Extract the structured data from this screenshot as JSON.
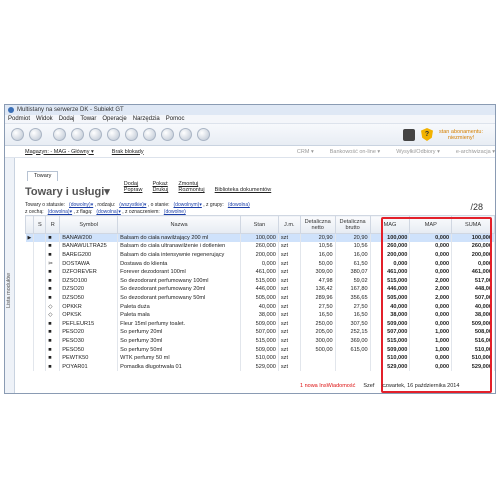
{
  "window": {
    "title": "Multistany na serwerze DK - Subiekt GT"
  },
  "menu": [
    "Podmiot",
    "Widok",
    "Dodaj",
    "Towar",
    "Operacje",
    "Narzędzia",
    "Pomoc"
  ],
  "promo": {
    "text": "stan abonamentu: niezmieny!"
  },
  "bar2": {
    "magazyn": "Magazyn: - MAG - Główny ▾",
    "blokady": "Brak blokady",
    "crm": "CRM ▾",
    "bank": "Bankowość on-line ▾",
    "wysylki": "Wysyłki/Odbiory ▾",
    "archiwizacja": "e-archiwizacja ▾"
  },
  "sidebar": {
    "label": "Lista modułów"
  },
  "tab": {
    "label": "Towary"
  },
  "header": {
    "title": "Towary i usługi",
    "title_caret": "▾",
    "count": "/28",
    "actions": [
      "Dodaj",
      "Pokaż",
      "Zmontuj",
      "",
      "Popraw",
      "Drukuj",
      "Rozmontuj",
      "Biblioteka dokumentów"
    ]
  },
  "filters": {
    "statusie_l": "Towary o statusie:",
    "statusie_v": "(dowolny)▾",
    "rodzaju_l": ", rodzaju:",
    "rodzaju_v": "(wszystkie)▾",
    "stanie_l": ", o stanie:",
    "stanie_v": "(dowolnym)▾",
    "grupy_l": ", z grupy:",
    "grupy_v": "(dowolna)",
    "cecha_l": "z cechą:",
    "cecha_v": "(dowolna)▾",
    "flaga_l": ", z flagą:",
    "flaga_v": "(dowolna)▾",
    "ozn_l": ", z oznaczeniem:",
    "ozn_v": "(dowolne)"
  },
  "columns": [
    "S",
    "R",
    "Symbol",
    "Nazwa",
    "Stan",
    "J.m.",
    "Detaliczna netto",
    "Detaliczna brutto",
    "MAG",
    "MAP",
    "SUMA"
  ],
  "rows": [
    [
      "",
      "■",
      "BANAW200",
      "Balsam do ciała nawilżający 200 ml",
      "100,000",
      "szt",
      "20,90",
      "20,90",
      "100,000",
      "0,000",
      "100,000"
    ],
    [
      "",
      "■",
      "BANAWULTRA25",
      "Balsam do ciała ultranawilżenie i dotlenien",
      "260,000",
      "szt",
      "10,56",
      "10,56",
      "260,000",
      "0,000",
      "260,000"
    ],
    [
      "",
      "■",
      "BAREG200",
      "Balsam do ciała intensywnie regenerujący",
      "200,000",
      "szt",
      "16,00",
      "16,00",
      "200,000",
      "0,000",
      "200,000"
    ],
    [
      "",
      "✂",
      "DOSTAWA",
      "Dostawa do klienta",
      "0,000",
      "szt",
      "50,00",
      "61,50",
      "0,000",
      "0,000",
      "0,000"
    ],
    [
      "",
      "■",
      "DZFOREVER",
      "Forever dezodorant 100ml",
      "461,000",
      "szt",
      "309,00",
      "380,07",
      "461,000",
      "0,000",
      "461,000"
    ],
    [
      "",
      "■",
      "DZSO100",
      "So dezodorant perfumowany 100ml",
      "515,000",
      "szt",
      "47,98",
      "59,02",
      "515,000",
      "2,000",
      "517,00"
    ],
    [
      "",
      "■",
      "DZSO20",
      "So dezodorant perfumowany 20ml",
      "446,000",
      "szt",
      "136,42",
      "167,80",
      "446,000",
      "2,000",
      "448,00"
    ],
    [
      "",
      "■",
      "DZSO50",
      "So dezodorant perfumowany 50ml",
      "505,000",
      "szt",
      "289,96",
      "356,65",
      "505,000",
      "2,000",
      "507,00"
    ],
    [
      "",
      "◇",
      "OPKKR",
      "Paleta duża",
      "40,000",
      "szt",
      "27,50",
      "27,50",
      "40,000",
      "0,000",
      "40,000"
    ],
    [
      "",
      "◇",
      "OPKSK",
      "Paleta mała",
      "38,000",
      "szt",
      "16,50",
      "16,50",
      "38,000",
      "0,000",
      "38,000"
    ],
    [
      "",
      "■",
      "PEFLEUR15",
      "Fleur 15ml perfumy toalet.",
      "509,000",
      "szt",
      "250,00",
      "307,50",
      "509,000",
      "0,000",
      "509,000"
    ],
    [
      "",
      "■",
      "PESO20",
      "So perfumy 20ml",
      "507,000",
      "szt",
      "205,00",
      "252,15",
      "507,000",
      "1,000",
      "508,00"
    ],
    [
      "",
      "■",
      "PESO30",
      "So perfumy 30ml",
      "515,000",
      "szt",
      "300,00",
      "369,00",
      "515,000",
      "1,000",
      "516,00"
    ],
    [
      "",
      "■",
      "PESO50",
      "So perfumy 50ml",
      "509,000",
      "szt",
      "500,00",
      "615,00",
      "509,000",
      "1,000",
      "510,00"
    ],
    [
      "",
      "■",
      "PEWTK50",
      "WTK perfumy 50 ml",
      "510,000",
      "szt",
      "",
      "",
      "510,000",
      "0,000",
      "510,000"
    ],
    [
      "",
      "■",
      "POYAR01",
      "Pomadka długotrwała 01",
      "529,000",
      "szt",
      "",
      "",
      "529,000",
      "0,000",
      "529,000"
    ]
  ],
  "status": {
    "message": "1 nowa InsWiadomość",
    "user": "Szef",
    "date": "czwartek, 16 października 2014"
  }
}
